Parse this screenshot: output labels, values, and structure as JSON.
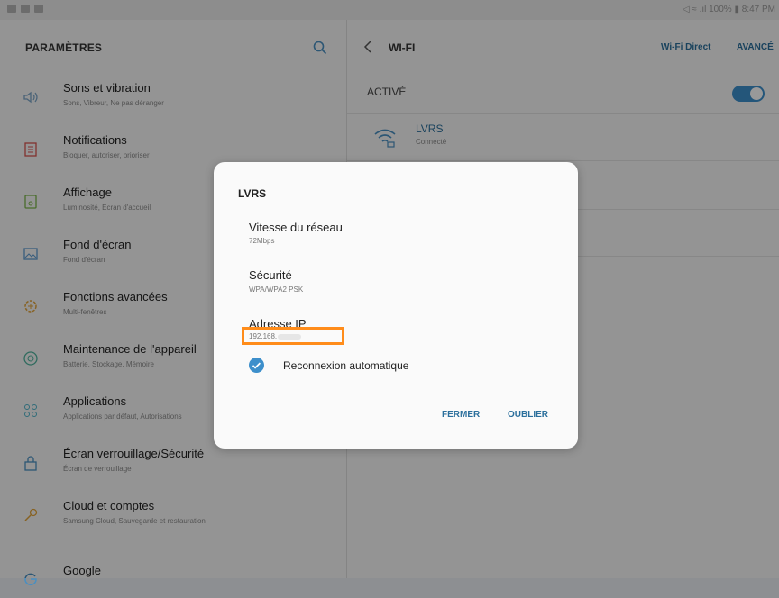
{
  "statusbar": {
    "right_text": "◁ ≈ .ıl 100% ▮ 8:47 PM"
  },
  "settings": {
    "title": "PARAMÈTRES",
    "items": [
      {
        "title": "Sons et vibration",
        "subtitle": "Sons, Vibreur, Ne pas déranger",
        "icon": "speaker-icon"
      },
      {
        "title": "Notifications",
        "subtitle": "Bloquer, autoriser, prioriser",
        "icon": "notifications-icon"
      },
      {
        "title": "Affichage",
        "subtitle": "Luminosité, Écran d'accueil",
        "icon": "display-icon"
      },
      {
        "title": "Fond d'écran",
        "subtitle": "Fond d'écran",
        "icon": "wallpaper-icon"
      },
      {
        "title": "Fonctions avancées",
        "subtitle": "Multi-fenêtres",
        "icon": "gear-plus-icon"
      },
      {
        "title": "Maintenance de l'appareil",
        "subtitle": "Batterie, Stockage, Mémoire",
        "icon": "maintenance-icon"
      },
      {
        "title": "Applications",
        "subtitle": "Applications par défaut, Autorisations",
        "icon": "apps-icon"
      },
      {
        "title": "Écran verrouillage/Sécurité",
        "subtitle": "Écran de verrouillage",
        "icon": "lock-icon"
      },
      {
        "title": "Cloud et comptes",
        "subtitle": "Samsung Cloud, Sauvegarde et restauration",
        "icon": "key-icon"
      },
      {
        "title": "Google",
        "subtitle": "",
        "icon": "google-icon"
      }
    ]
  },
  "wifi": {
    "title": "WI-FI",
    "direct_label": "Wi-Fi Direct",
    "advanced_label": "AVANCÉ",
    "active_label": "ACTIVÉ",
    "toggle_on": true,
    "network": {
      "name": "LVRS",
      "status": "Connecté"
    }
  },
  "dialog": {
    "title": "LVRS",
    "speed_label": "Vitesse du réseau",
    "speed_value": "72Mbps",
    "security_label": "Sécurité",
    "security_value": "WPA/WPA2 PSK",
    "ip_label": "Adresse IP",
    "ip_value": "192.168.",
    "reconnect_label": "Reconnexion automatique",
    "reconnect_checked": true,
    "close_label": "FERMER",
    "forget_label": "OUBLIER"
  },
  "colors": {
    "accent": "#2b6f9c",
    "toggle": "#3d8fcb",
    "highlight": "#ff8c1a",
    "icon_tint": "#d88b2c"
  }
}
